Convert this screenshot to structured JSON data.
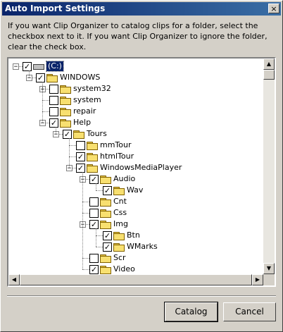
{
  "window": {
    "title": "Auto Import Settings",
    "close_glyph": "×"
  },
  "description": "If you want Clip Organizer to catalog clips for a folder, select the checkbox next to it. If you want Clip Organizer to ignore the folder, clear the check box.",
  "tree": {
    "nodes": [
      {
        "label": "(C:)",
        "checked": true,
        "expander": "−",
        "selected": true
      },
      {
        "label": "WINDOWS",
        "checked": true,
        "expander": "−"
      },
      {
        "label": "system32",
        "checked": false,
        "expander": "+"
      },
      {
        "label": "system",
        "checked": false,
        "expander": ""
      },
      {
        "label": "repair",
        "checked": false,
        "expander": ""
      },
      {
        "label": "Help",
        "checked": true,
        "expander": "−"
      },
      {
        "label": "Tours",
        "checked": true,
        "expander": "−"
      },
      {
        "label": "mmTour",
        "checked": false,
        "expander": ""
      },
      {
        "label": "htmlTour",
        "checked": true,
        "expander": ""
      },
      {
        "label": "WindowsMediaPlayer",
        "checked": true,
        "expander": "−"
      },
      {
        "label": "Audio",
        "checked": true,
        "expander": "−"
      },
      {
        "label": "Wav",
        "checked": true,
        "expander": ""
      },
      {
        "label": "Cnt",
        "checked": false,
        "expander": ""
      },
      {
        "label": "Css",
        "checked": false,
        "expander": ""
      },
      {
        "label": "Img",
        "checked": true,
        "expander": "−"
      },
      {
        "label": "Btn",
        "checked": true,
        "expander": ""
      },
      {
        "label": "WMarks",
        "checked": true,
        "expander": ""
      },
      {
        "label": "Scr",
        "checked": false,
        "expander": ""
      },
      {
        "label": "Video",
        "checked": true,
        "expander": ""
      }
    ],
    "check_glyph": "✓"
  },
  "scrollbars": {
    "up_glyph": "▲",
    "down_glyph": "▼",
    "left_glyph": "◀",
    "right_glyph": "▶"
  },
  "buttons": {
    "catalog": "Catalog",
    "cancel": "Cancel"
  }
}
